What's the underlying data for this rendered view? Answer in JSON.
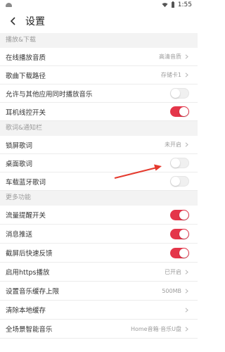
{
  "status": {
    "time": "1:55"
  },
  "header": {
    "title": "设置"
  },
  "sections": [
    {
      "label": "播放&下载",
      "items": [
        {
          "label": "在线播放音质",
          "type": "value",
          "value": "高清音质"
        },
        {
          "label": "歌曲下载路径",
          "type": "value",
          "value": "存储卡1"
        },
        {
          "label": "允许与其他应用同时播放音乐",
          "type": "toggle",
          "on": false
        },
        {
          "label": "耳机线控开关",
          "type": "toggle",
          "on": true
        }
      ]
    },
    {
      "label": "歌词&通知栏",
      "items": [
        {
          "label": "锁屏歌词",
          "type": "value",
          "value": "未开启"
        },
        {
          "label": "桌面歌词",
          "type": "toggle",
          "on": false
        },
        {
          "label": "车载蓝牙歌词",
          "type": "toggle",
          "on": false
        }
      ]
    },
    {
      "label": "更多功能",
      "items": [
        {
          "label": "流量提醒开关",
          "type": "toggle",
          "on": true
        },
        {
          "label": "消息推送",
          "type": "toggle",
          "on": true
        },
        {
          "label": "截屏后快速反馈",
          "type": "toggle",
          "on": true
        },
        {
          "label": "启用https播放",
          "type": "value",
          "value": "已开启"
        },
        {
          "label": "设置音乐缓存上限",
          "type": "value",
          "value": "500MB"
        },
        {
          "label": "清除本地缓存",
          "type": "value",
          "value": ""
        },
        {
          "label": "全场景智能音乐",
          "type": "value",
          "value": "Home音箱·音乐U盘"
        }
      ]
    }
  ],
  "colors": {
    "accent": "#e4364a",
    "annotation_arrow": "#e53a2e"
  }
}
